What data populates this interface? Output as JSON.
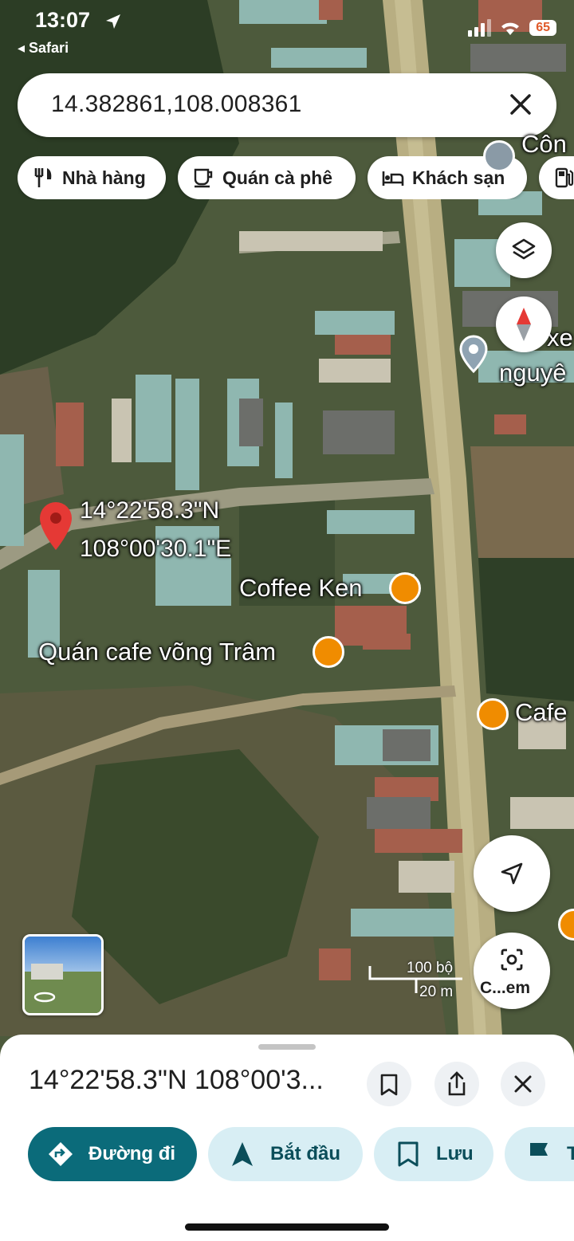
{
  "status_bar": {
    "time": "13:07",
    "back_app": "◂ Safari",
    "battery": "65"
  },
  "search": {
    "query": "14.382861,108.008361"
  },
  "chips": [
    {
      "label": "Nhà hàng",
      "icon": "restaurant-icon"
    },
    {
      "label": "Quán cà phê",
      "icon": "coffee-icon"
    },
    {
      "label": "Khách sạn",
      "icon": "hotel-icon"
    },
    {
      "label": "",
      "icon": "gas-station-icon"
    }
  ],
  "map": {
    "pin_lat": "14°22'58.3\"N",
    "pin_lng": "108°00'30.1\"E",
    "labels": {
      "top_right_1": "Côn",
      "xe": "xe",
      "nguyen": "nguyê",
      "coffee_ken": "Coffee Ken",
      "quan_cafe_vong_tram": "Quán cafe võng Trâm",
      "cafe": "Cafe"
    },
    "scale": {
      "ft": "100 bộ",
      "m": "20 m"
    },
    "camera_label": "C...em"
  },
  "sheet": {
    "title": "14°22'58.3\"N 108°00'3...",
    "actions": [
      {
        "label": "Đường đi",
        "icon": "directions-icon",
        "primary": true
      },
      {
        "label": "Bắt đầu",
        "icon": "navigation-arrow-icon",
        "primary": false
      },
      {
        "label": "Lưu",
        "icon": "bookmark-icon",
        "primary": false
      },
      {
        "label": "T",
        "icon": "flag-icon",
        "primary": false
      }
    ]
  },
  "colors": {
    "accent": "#0b6b7a",
    "secondary_bg": "#d8eef4",
    "pin": "#d93025",
    "poi": "#f08c00"
  }
}
